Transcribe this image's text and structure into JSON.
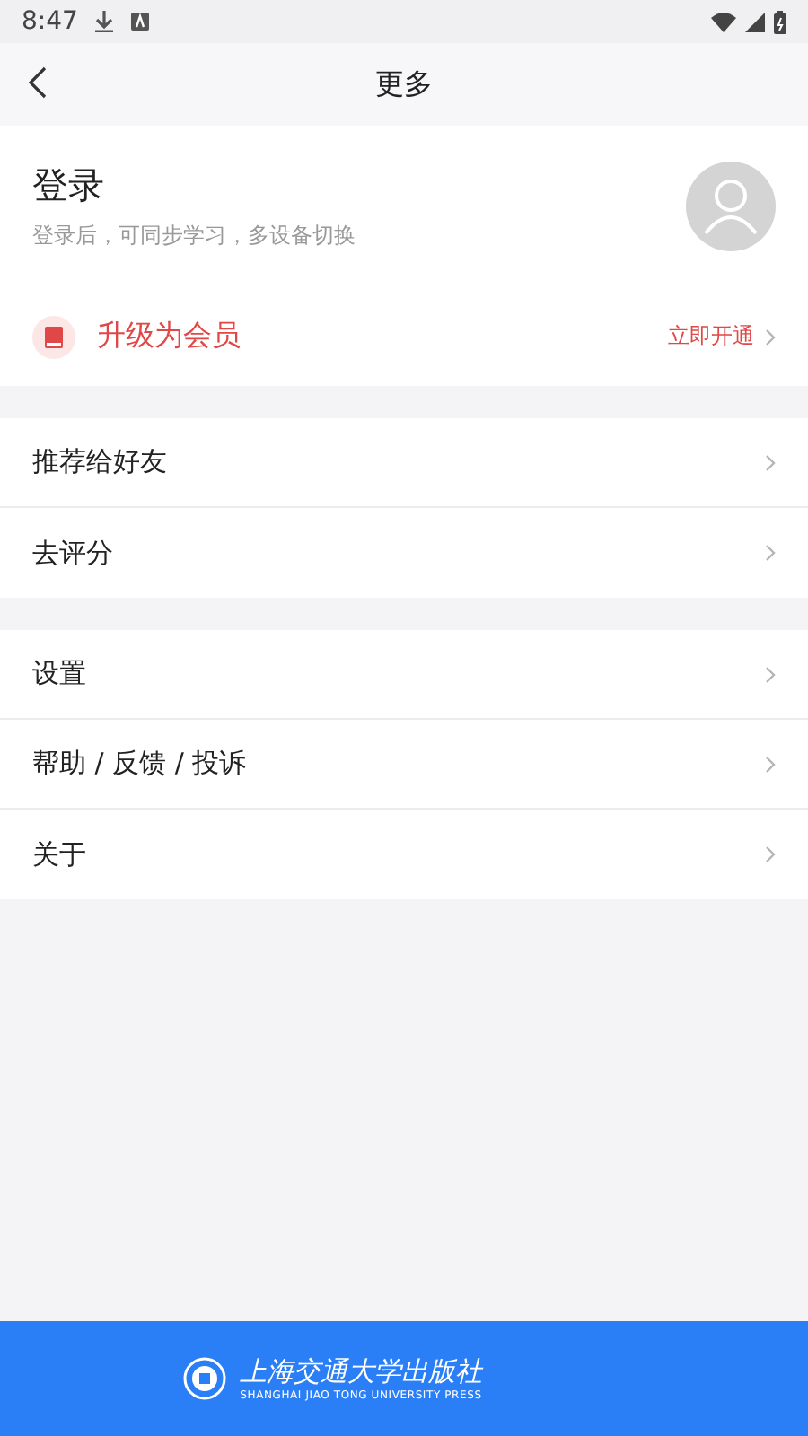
{
  "status_bar": {
    "time": "8:47"
  },
  "header": {
    "title": "更多"
  },
  "profile": {
    "title": "登录",
    "subtitle": "登录后，可同步学习，多设备切换"
  },
  "vip": {
    "label": "升级为会员",
    "action": "立即开通"
  },
  "menu_groups": [
    {
      "items": [
        {
          "label": "推荐给好友"
        },
        {
          "label": "去评分"
        }
      ]
    },
    {
      "items": [
        {
          "label": "设置"
        },
        {
          "label": "帮助 / 反馈 / 投诉"
        },
        {
          "label": "关于"
        }
      ]
    }
  ],
  "footer": {
    "logo_text": "上海交通大学出版社",
    "logo_subtext": "SHANGHAI JIAO TONG UNIVERSITY PRESS"
  }
}
